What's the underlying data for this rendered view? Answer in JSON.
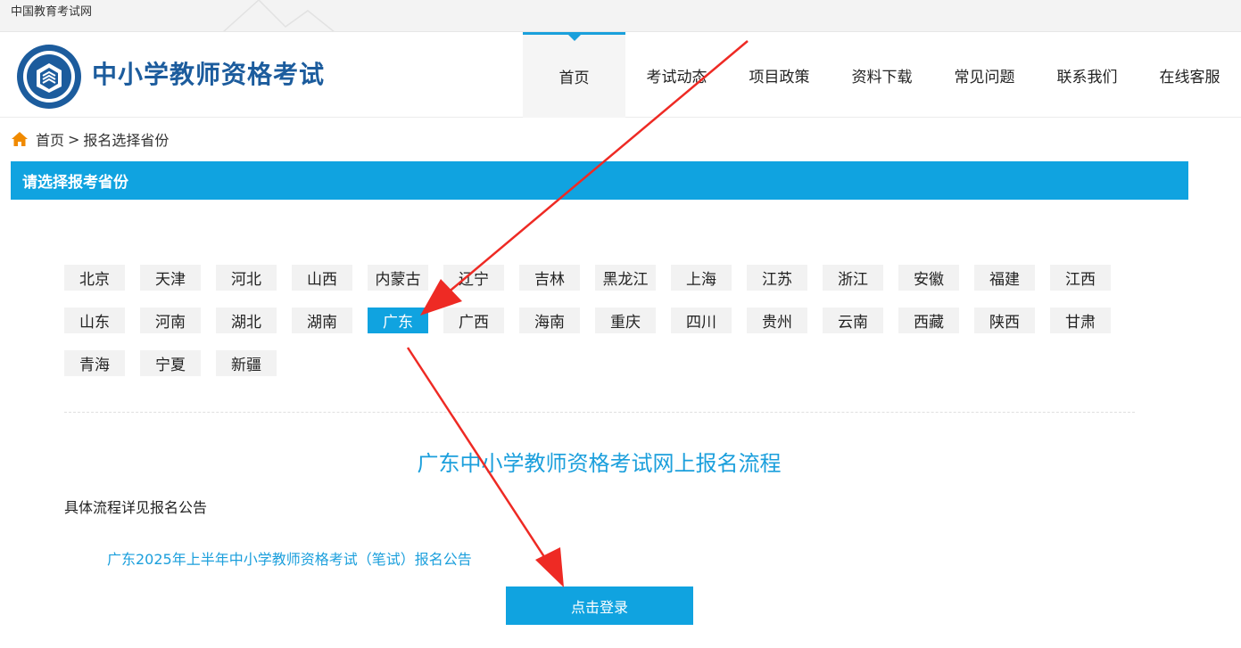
{
  "topbar": {
    "site_name": "中国教育考试网"
  },
  "header": {
    "logo_title": "中小学教师资格考试"
  },
  "nav": [
    {
      "label": "首页",
      "active": true
    },
    {
      "label": "考试动态",
      "active": false
    },
    {
      "label": "项目政策",
      "active": false
    },
    {
      "label": "资料下载",
      "active": false
    },
    {
      "label": "常见问题",
      "active": false
    },
    {
      "label": "联系我们",
      "active": false
    },
    {
      "label": "在线客服",
      "active": false
    }
  ],
  "breadcrumb": {
    "home": "首页",
    "separator": ">",
    "current": "报名选择省份"
  },
  "section_title": "请选择报考省份",
  "provinces": [
    "北京",
    "天津",
    "河北",
    "山西",
    "内蒙古",
    "辽宁",
    "吉林",
    "黑龙江",
    "上海",
    "江苏",
    "浙江",
    "安徽",
    "福建",
    "江西",
    "山东",
    "河南",
    "湖北",
    "湖南",
    "广东",
    "广西",
    "海南",
    "重庆",
    "四川",
    "贵州",
    "云南",
    "西藏",
    "陕西",
    "甘肃",
    "青海",
    "宁夏",
    "新疆"
  ],
  "selected_province": "广东",
  "flow": {
    "title": "广东中小学教师资格考试网上报名流程",
    "detail": "具体流程详见报名公告",
    "notice_link": "广东2025年上半年中小学教师资格考试（笔试）报名公告",
    "login_button": "点击登录"
  },
  "colors": {
    "accent": "#10a3e0",
    "brand": "#1c5c9d",
    "annotation": "#ee2a24"
  }
}
